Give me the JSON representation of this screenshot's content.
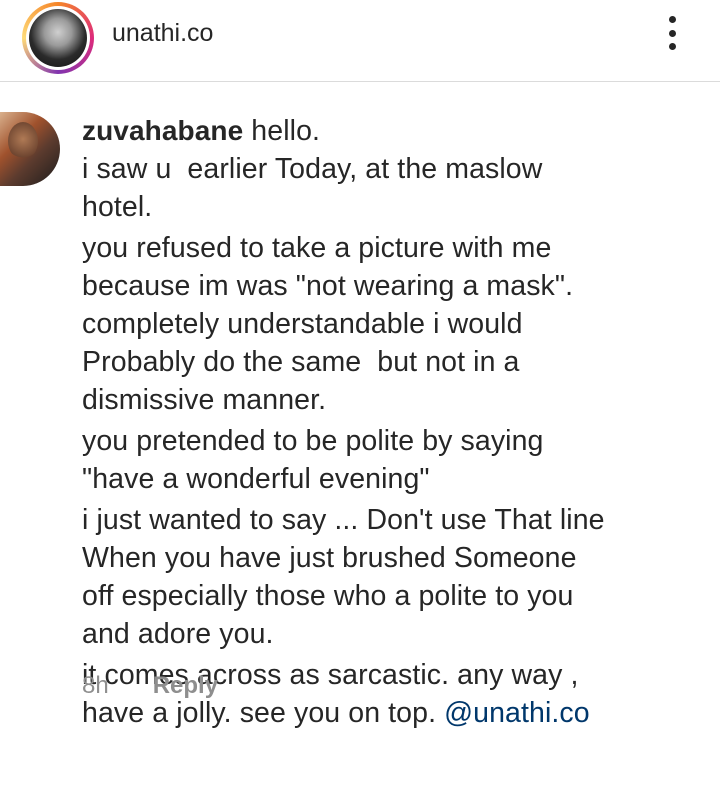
{
  "header": {
    "username": "unathi.co",
    "avatar_icon": "profile-photo",
    "more_icon": "more-vertical-icon"
  },
  "comment": {
    "author": "zuvahabane",
    "paragraphs": [
      " hello.\ni saw u  earlier Today, at the maslow\nhotel.",
      "you refused to take a picture with me\nbecause im was \"not wearing a mask\".\ncompletely understandable i would\nProbably do the same  but not in a\ndismissive manner.",
      "you pretended to be polite by saying\n\"have a wonderful evening\"",
      "i just wanted to say ... Don't use That line\nWhen you have just brushed Someone\noff especially those who a polite to you\nand adore you.",
      "it comes across as sarcastic. any way ,\nhave a jolly. see you on top. "
    ],
    "mention": "@unathi.co",
    "timestamp": "8h",
    "reply_label": "Reply"
  },
  "colors": {
    "text": "#262626",
    "secondary": "#8e8e8e",
    "mention": "#00376b",
    "divider": "#dbdbdb"
  }
}
